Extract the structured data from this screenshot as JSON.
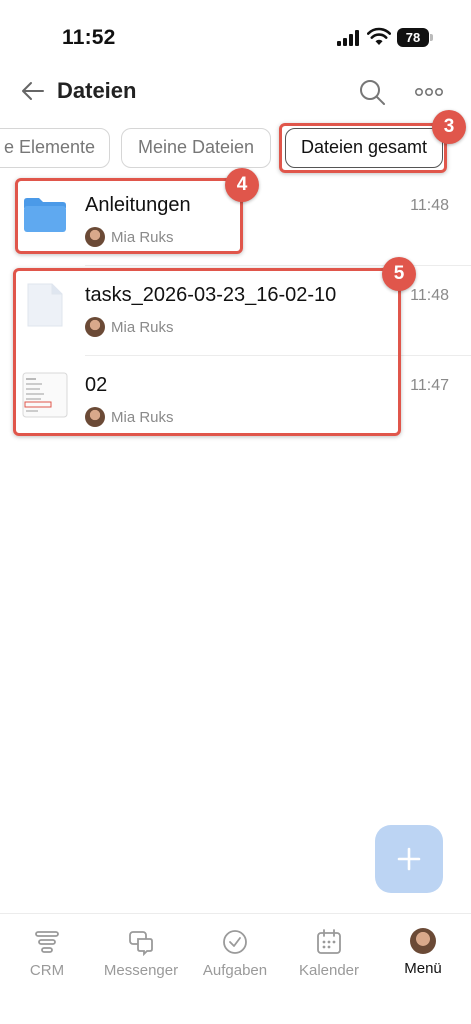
{
  "status": {
    "time": "11:52",
    "battery": "78"
  },
  "header": {
    "title": "Dateien"
  },
  "tabs": [
    {
      "label": "e Elemente"
    },
    {
      "label": "Meine Dateien"
    },
    {
      "label": "Dateien gesamt"
    }
  ],
  "items": [
    {
      "type": "folder",
      "title": "Anleitungen",
      "author": "Mia Ruks",
      "time": "11:48"
    },
    {
      "type": "file",
      "title": "tasks_2026-03-23_16-02-10",
      "author": "Mia Ruks",
      "time": "11:48"
    },
    {
      "type": "image",
      "title": "02",
      "author": "Mia Ruks",
      "time": "11:47"
    }
  ],
  "annotations": {
    "tabs_badge": "3",
    "folder_badge": "4",
    "files_badge": "5",
    "color": "#e0564b"
  },
  "fab": {
    "label": "+"
  },
  "nav": [
    {
      "label": "CRM",
      "icon": "crm-icon"
    },
    {
      "label": "Messenger",
      "icon": "messenger-icon"
    },
    {
      "label": "Aufgaben",
      "icon": "tasks-icon"
    },
    {
      "label": "Kalender",
      "icon": "calendar-icon"
    },
    {
      "label": "Menü",
      "icon": "avatar"
    }
  ]
}
